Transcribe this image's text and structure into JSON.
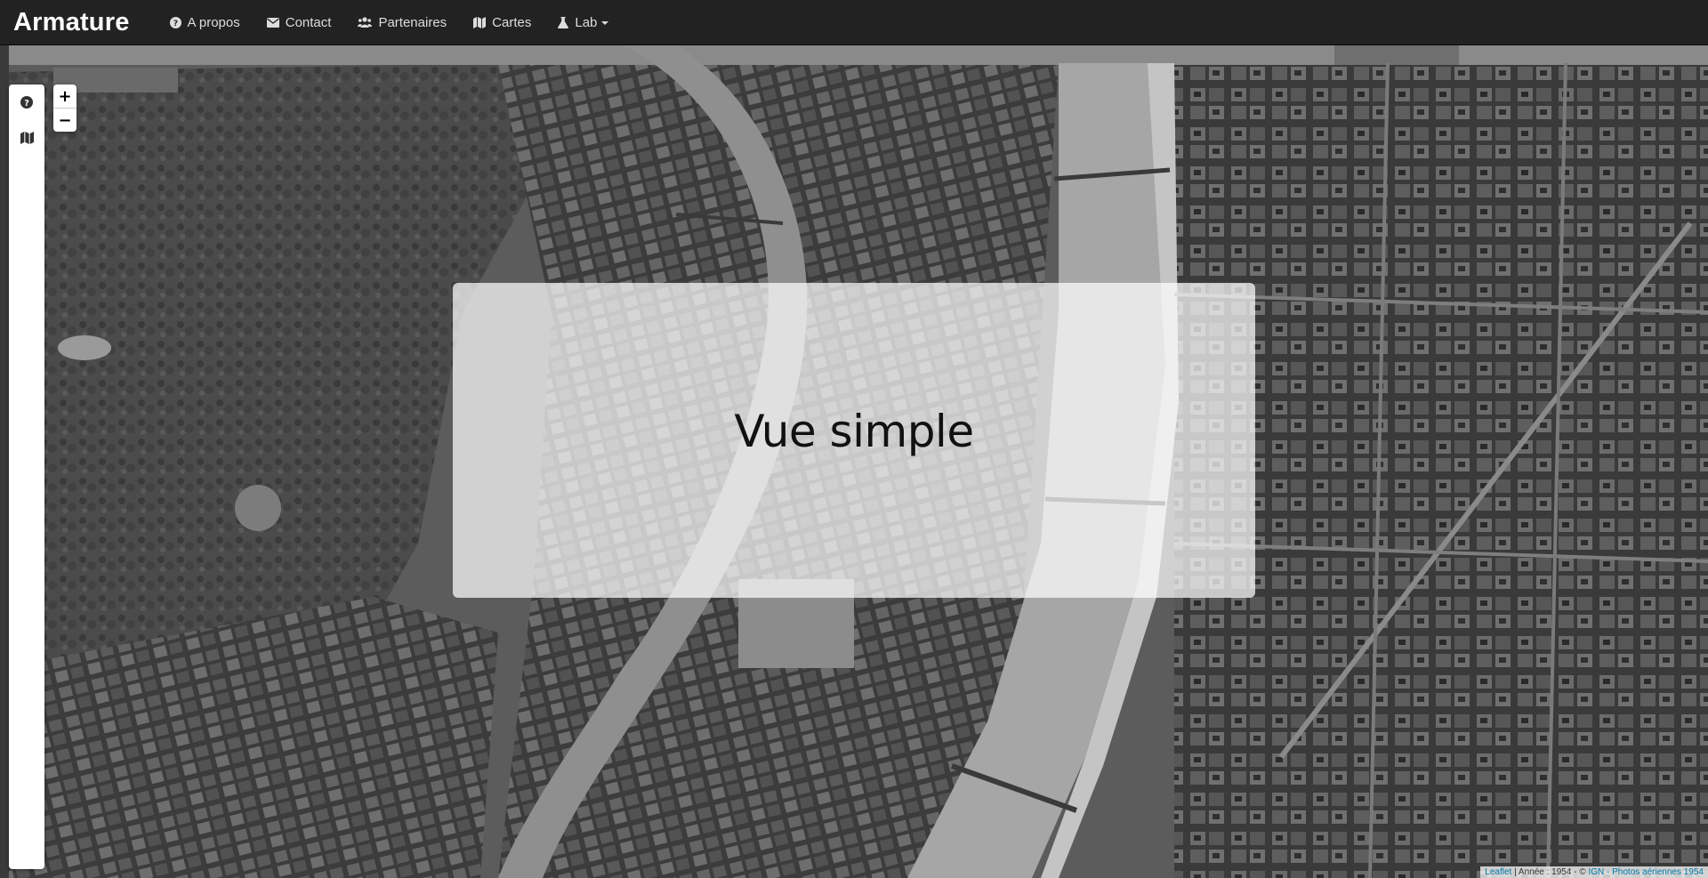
{
  "navbar": {
    "brand": "Armature",
    "items": [
      {
        "label": "A propos",
        "icon": "question-circle-icon"
      },
      {
        "label": "Contact",
        "icon": "envelope-icon"
      },
      {
        "label": "Partenaires",
        "icon": "users-icon"
      },
      {
        "label": "Cartes",
        "icon": "map-icon"
      },
      {
        "label": "Lab",
        "icon": "flask-icon"
      }
    ]
  },
  "sidebar": {
    "tabs": [
      {
        "icon": "question-circle-icon"
      },
      {
        "icon": "map-icon"
      }
    ]
  },
  "zoom": {
    "in_label": "+",
    "out_label": "−"
  },
  "overlay": {
    "title": "Vue simple"
  },
  "attribution": {
    "leaflet": "Leaflet",
    "text": " | Année : 1954 - © ",
    "ign": "IGN - Photos aériennes 1954"
  },
  "colors": {
    "navbar": "#222222",
    "link": "#0078A8"
  }
}
